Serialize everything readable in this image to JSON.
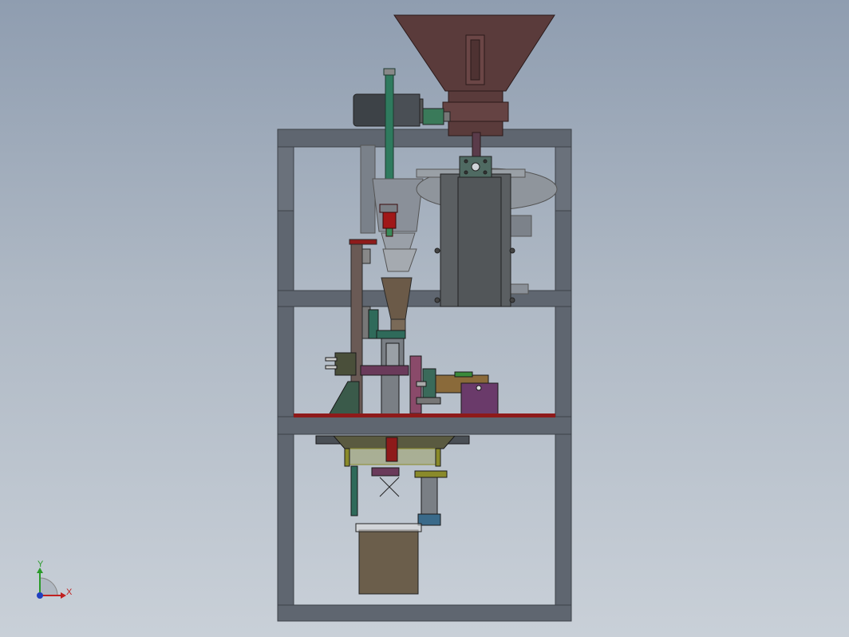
{
  "view": {
    "background_top": "#8f9db0",
    "background_bottom": "#c9d0d8"
  },
  "colors": {
    "frame": "#5f6670",
    "frame_edge": "#3c4148",
    "hopper": "#5a3b3b",
    "motor": "#4a4f55",
    "shaft": "#2f7a5e",
    "valve_red": "#a01818",
    "plate_red": "#8e1a1a",
    "housing": "#5b5f62",
    "bracket_olive": "#8a8a2a",
    "cylinder_bronze": "#8a6a3a",
    "purple_block": "#6a3a6a",
    "bag": "#6b5e4b"
  },
  "triad": {
    "x_label": "X",
    "y_label": "Y",
    "x_color": "#c02020",
    "y_color": "#2a9a2a",
    "z_color": "#2040c0"
  }
}
